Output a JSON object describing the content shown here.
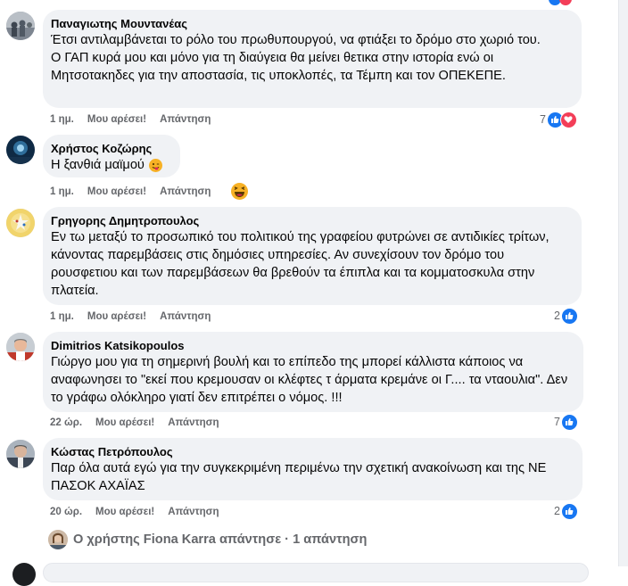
{
  "comments": [
    {
      "author": "Παναγιωτης Μουντανέας",
      "text": "Έτσι αντιλαμβάνεται το ρόλο του πρωθυπουργού, να φτιάξει το δρόμο στο χωριό του.\nΟ ΓΑΠ κυρά μου και μόνο για τη διαύγεια θα μείνει θετικα στην ιστορία ενώ οι Μητσοτακηδες για την αποστασία, τις υποκλοπές, τα Τέμπη και τον ΟΠΕΚΕΠΕ.",
      "time": "1 ημ.",
      "like_label": "Μου αρέσει!",
      "reply_label": "Απάντηση",
      "reaction_count": "7",
      "reactions": [
        "like-icon",
        "heart-icon"
      ]
    },
    {
      "author": "Χρήστος Κοζώρης",
      "text": "Η ξανθιά μαϊμού",
      "time": "1 ημ.",
      "like_label": "Μου αρέσει!",
      "reply_label": "Απάντηση",
      "reaction_count": "",
      "reactions": [
        "laughing-emoji-icon"
      ]
    },
    {
      "author": "Γρηγορης Δημητροπουλος",
      "text": "Εν τω μεταξύ το προσωπικό του πολιτικού της γραφείου φυτρώνει σε αντιδικίες τρίτων, κάνοντας παρεμβάσεις στις δημόσιες υπηρεσίες. Αν συνεχίσουν τον δρόμο του ρουσφετιου και των παρεμβάσεων θα βρεθούν τα έπιπλα και τα κομματοσκυλα στην πλατεία.",
      "time": "1 ημ.",
      "like_label": "Μου αρέσει!",
      "reply_label": "Απάντηση",
      "reaction_count": "2",
      "reactions": [
        "like-icon"
      ]
    },
    {
      "author": "Dimitrios Katsikopoulos",
      "text": "Γιώργο μου για τη σημερινή βουλή και το επίπεδο της μπορεί κάλλιστα κάποιος να αναφωνησει το \"εκεί που κρεμουσαν οι κλέφτες τ άρματα κρεμάνε οι Γ.... τα νταουλια\". Δεν το γράφω ολόκληρο γιατί δεν επιτρέπει ο νόμος. !!!",
      "time": "22 ώρ.",
      "like_label": "Μου αρέσει!",
      "reply_label": "Απάντηση",
      "reaction_count": "7",
      "reactions": [
        "like-icon"
      ]
    },
    {
      "author": "Κώστας Πετρόπουλος",
      "text": "Παρ όλα αυτά εγώ για την συγκεκριμένη περιμένω την σχετική ανακοίνωση και της ΝΕ ΠΑΣΟΚ ΑΧΑΪΑΣ",
      "time": "20 ώρ.",
      "like_label": "Μου αρέσει!",
      "reply_label": "Απάντηση",
      "reaction_count": "2",
      "reactions": [
        "like-icon"
      ]
    }
  ],
  "reply_summary": {
    "text": "Ο χρήστης Fiona Karra απάντησε · 1 απάντηση"
  },
  "colors": {
    "bubble": "#f0f2f5",
    "meta_text": "#65676b",
    "like_blue": "#1877f2",
    "heart_red": "#f33e58"
  }
}
